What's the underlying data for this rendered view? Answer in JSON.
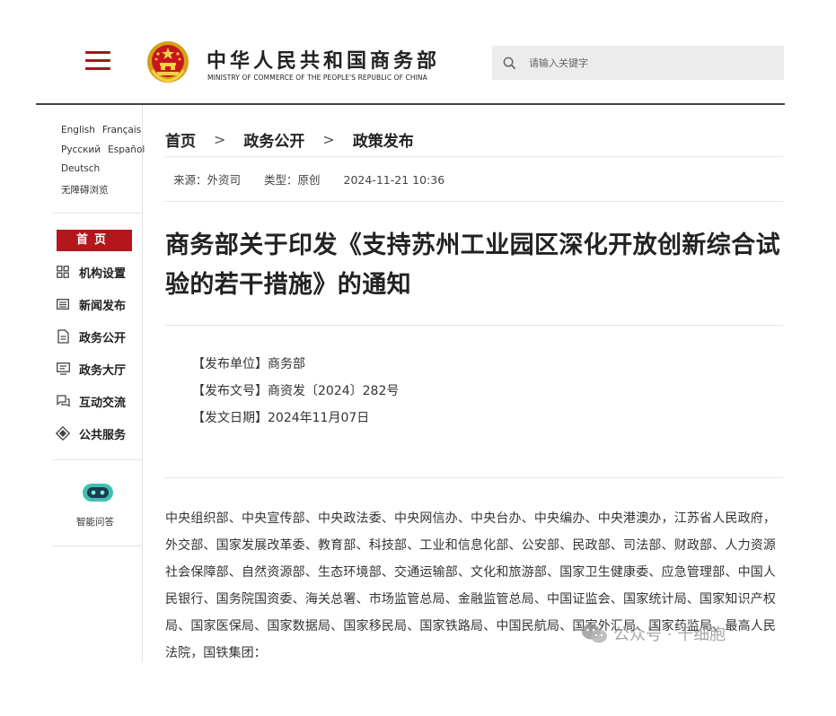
{
  "header": {
    "title": "中华人民共和国商务部",
    "subtitle": "MINISTRY OF COMMERCE OF THE PEOPLE'S REPUBLIC OF CHINA",
    "search_placeholder": "请输入关键字",
    "menu_icon": "hamburger-menu-icon",
    "emblem": "national-emblem-icon"
  },
  "sidebar": {
    "languages_row1": [
      "English",
      "Français"
    ],
    "languages_row2": [
      "Русский",
      "Español"
    ],
    "languages_row3": [
      "Deutsch"
    ],
    "accessibility": "无障碍浏览",
    "home_label": "首页",
    "nav": [
      {
        "label": "机构设置",
        "icon": "grid-icon"
      },
      {
        "label": "新闻发布",
        "icon": "news-icon"
      },
      {
        "label": "政务公开",
        "icon": "document-icon"
      },
      {
        "label": "政务大厅",
        "icon": "monitor-icon"
      },
      {
        "label": "互动交流",
        "icon": "chat-icon"
      },
      {
        "label": "公共服务",
        "icon": "diamond-icon"
      }
    ],
    "ai_label": "智能问答",
    "ai_icon": "robot-chat-icon"
  },
  "breadcrumb": {
    "items": [
      "首页",
      "政务公开",
      "政策发布"
    ],
    "separator": ">"
  },
  "meta": {
    "source": "来源：外资司",
    "type": "类型：原创",
    "datetime": "2024-11-21 10:36"
  },
  "article": {
    "title": "商务部关于印发《支持苏州工业园区深化开放创新综合试验的若干措施》的通知",
    "issuer": "【发布单位】商务部",
    "doc_number": "【发布文号】商资发〔2024〕282号",
    "issue_date": "【发文日期】2024年11月07日",
    "body": "中央组织部、中央宣传部、中央政法委、中央网信办、中央台办、中央编办、中央港澳办，江苏省人民政府，外交部、国家发展改革委、教育部、科技部、工业和信息化部、公安部、民政部、司法部、财政部、人力资源社会保障部、自然资源部、生态环境部、交通运输部、文化和旅游部、国家卫生健康委、应急管理部、中国人民银行、国务院国资委、海关总署、市场监管总局、金融监管总局、中国证监会、国家统计局、国家知识产权局、国家医保局、国家数据局、国家移民局、国家铁路局、中国民航局、国家外汇局、国家药监局、最高人民法院，国铁集团："
  },
  "watermark": {
    "text": "公众号 · 千细胞",
    "icon": "wechat-icon"
  },
  "colors": {
    "brand_red": "#b3171c",
    "header_line": "#444444",
    "search_bg": "#ececec"
  }
}
